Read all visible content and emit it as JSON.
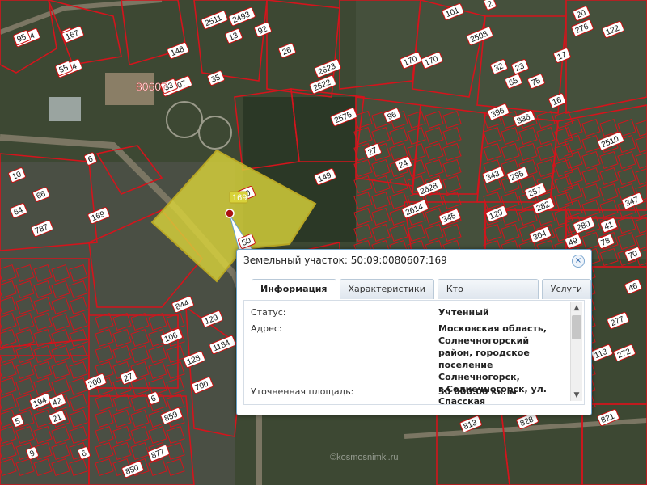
{
  "map": {
    "colors": {
      "terrain": "#3f4a36",
      "forest": "#2e3a28",
      "parcel_border": "#d4141c",
      "selected_fill": "#d8d23a",
      "selected_border": "#b8a624"
    },
    "labels": [
      "2314",
      "5",
      "2504",
      "80607",
      "35",
      "2493",
      "92",
      "13",
      "26",
      "2511",
      "148",
      "2623",
      "2622",
      "2575",
      "96",
      "170",
      "170",
      "2508",
      "101",
      "2",
      "20",
      "276",
      "122",
      "32",
      "23",
      "65",
      "75",
      "396",
      "336",
      "16",
      "17",
      "2510",
      "6",
      "10",
      "66",
      "64",
      "787",
      "169",
      "150",
      "149",
      "27",
      "24",
      "2628",
      "2614",
      "345",
      "129",
      "343",
      "295",
      "282",
      "347",
      "280",
      "41",
      "49",
      "78",
      "70",
      "46",
      "257",
      "304",
      "194",
      "42",
      "21",
      "5",
      "9",
      "6",
      "850",
      "877",
      "859",
      "200",
      "128",
      "700",
      "6",
      "106",
      "27",
      "844",
      "129",
      "1184",
      "821",
      "813",
      "828",
      "835",
      "690",
      "113",
      "277",
      "272",
      "50",
      "95",
      "167",
      "55",
      "33"
    ],
    "big_label": "80607",
    "selected_parcel_label": "169",
    "watermark": "©kosmosnimki.ru"
  },
  "popup": {
    "title": "Земельный участок: 50:09:0080607:169",
    "close_label": "×",
    "tabs": [
      {
        "label": "Информация",
        "active": true
      },
      {
        "label": "Характеристики",
        "active": false
      },
      {
        "label": "Кто обслуживает?",
        "active": false
      },
      {
        "label": "Услуги",
        "active": false
      }
    ],
    "fields": [
      {
        "label": "Статус:",
        "value": "Учтенный"
      },
      {
        "label": "Адрес:",
        "value": "Московская область, Солнечногорский район, городское поселение Солнечногорск, г.Солнечногорск, ул. Спасская"
      },
      {
        "label": "Уточненная площадь:",
        "value": "30 000.00 кв. м"
      }
    ],
    "scroll_up": "▲",
    "scroll_down": "▼"
  }
}
